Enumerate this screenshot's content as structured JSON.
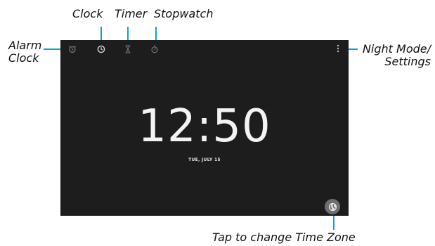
{
  "callouts": {
    "clock": "Clock",
    "timer": "Timer",
    "stopwatch": "Stopwatch",
    "alarm_line1": "Alarm",
    "alarm_line2": "Clock",
    "night_line1": "Night Mode/",
    "night_line2": "Settings",
    "timezone": "Tap to change Time Zone"
  },
  "screen": {
    "time": "12:50",
    "date": "TUE, JULY 15"
  },
  "icons": {
    "alarm_tab": "alarm-clock-icon",
    "clock_tab": "clock-icon",
    "timer_tab": "hourglass-icon",
    "stopwatch_tab": "stopwatch-icon",
    "menu": "vertical-dots-icon",
    "timezone": "globe-icon"
  },
  "colors": {
    "leader": "#0fa0d9",
    "screen_bg": "#1d1d1d",
    "time_text": "#f3f3f3",
    "fab": "#6f6f6f"
  }
}
